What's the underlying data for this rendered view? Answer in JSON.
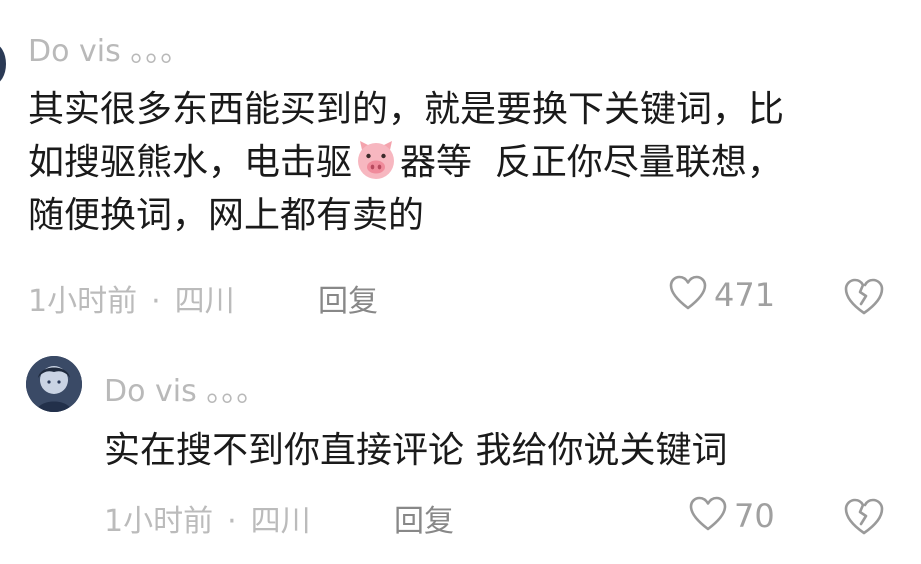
{
  "comments": [
    {
      "username": "Do vis 。。。",
      "text_before_emoji": "其实很多东西能买到的，就是要换下关键词，比\n如搜驱熊水，电击驱",
      "emoji": "pig-face-emoji",
      "text_after_emoji": "器等  反正你尽量联想，\n随便换词，网上都有卖的",
      "time": "1小时前",
      "location": "四川",
      "separator": "·",
      "reply_label": "回复",
      "likes": "471"
    },
    {
      "username": "Do vis 。。。",
      "text": "实在搜不到你直接评论 我给你说关键词",
      "time": "1小时前",
      "location": "四川",
      "separator": "·",
      "reply_label": "回复",
      "likes": "70"
    }
  ],
  "colors": {
    "username": "#b9b9b9",
    "body": "#1a1a1a",
    "meta": "#bbbbbb",
    "icon": "#9a9a9a"
  }
}
